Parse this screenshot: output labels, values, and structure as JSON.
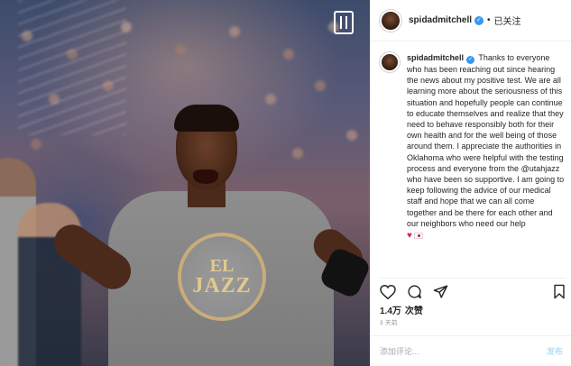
{
  "post": {
    "username": "spidadmitchell",
    "verified_icon": "verified-badge-icon",
    "follow_status": "已关注",
    "separator": "•",
    "caption_username": "spidadmitchell",
    "caption": "Thanks to everyone who has been reaching out since hearing the news about my positive test. We are all learning more about the seriousness of this situation and hopefully people can continue to educate themselves and realize that they need to behave responsibly both for their own health and for the well being of those around them. I appreciate the authorities in Oklahoma who were helpful with the testing process and everyone from the @utahjazz who have been so supportive. I am going to keep following the advice of our medical staff and hope that we can all come together and be there for each other and our neighbors who need our help",
    "caption_emojis": [
      "heart-emoji",
      "flag-emoji"
    ],
    "views_count": "1.4万",
    "views_label": "次赞",
    "date": "3 天前",
    "comment_placeholder": "添加评论...",
    "post_button": "发布"
  },
  "photo": {
    "shirt_logo_line1": "EL",
    "shirt_logo_line2": "JAZZ",
    "media_icon": "reel-icon"
  },
  "icons": {
    "like": "heart-icon",
    "comment": "comment-icon",
    "share": "share-icon",
    "save": "bookmark-icon"
  },
  "colors": {
    "verified": "#3897f0",
    "text": "#262626",
    "muted": "#8e8e8e",
    "post_button": "#b2dffc",
    "heart": "#e0245e"
  }
}
